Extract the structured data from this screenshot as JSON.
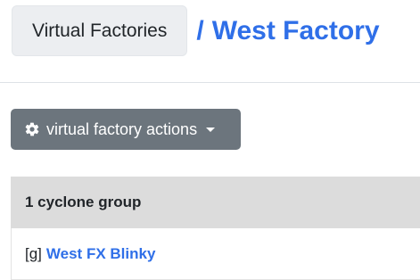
{
  "breadcrumb": {
    "parent_label": "Virtual Factories",
    "separator": "/",
    "current": "West Factory"
  },
  "actions": {
    "label": "virtual factory actions",
    "icon": "gear-icon",
    "dropdown_icon": "caret-down-icon"
  },
  "groups": {
    "header": "1 cyclone group",
    "items": [
      {
        "prefix": "[g]",
        "name": "West FX Blinky"
      }
    ]
  },
  "colors": {
    "link": "#2f6fe8",
    "button_bg": "#6c757d",
    "panel_header_bg": "#dcdcdc",
    "crumb_bg": "#eceef1"
  }
}
